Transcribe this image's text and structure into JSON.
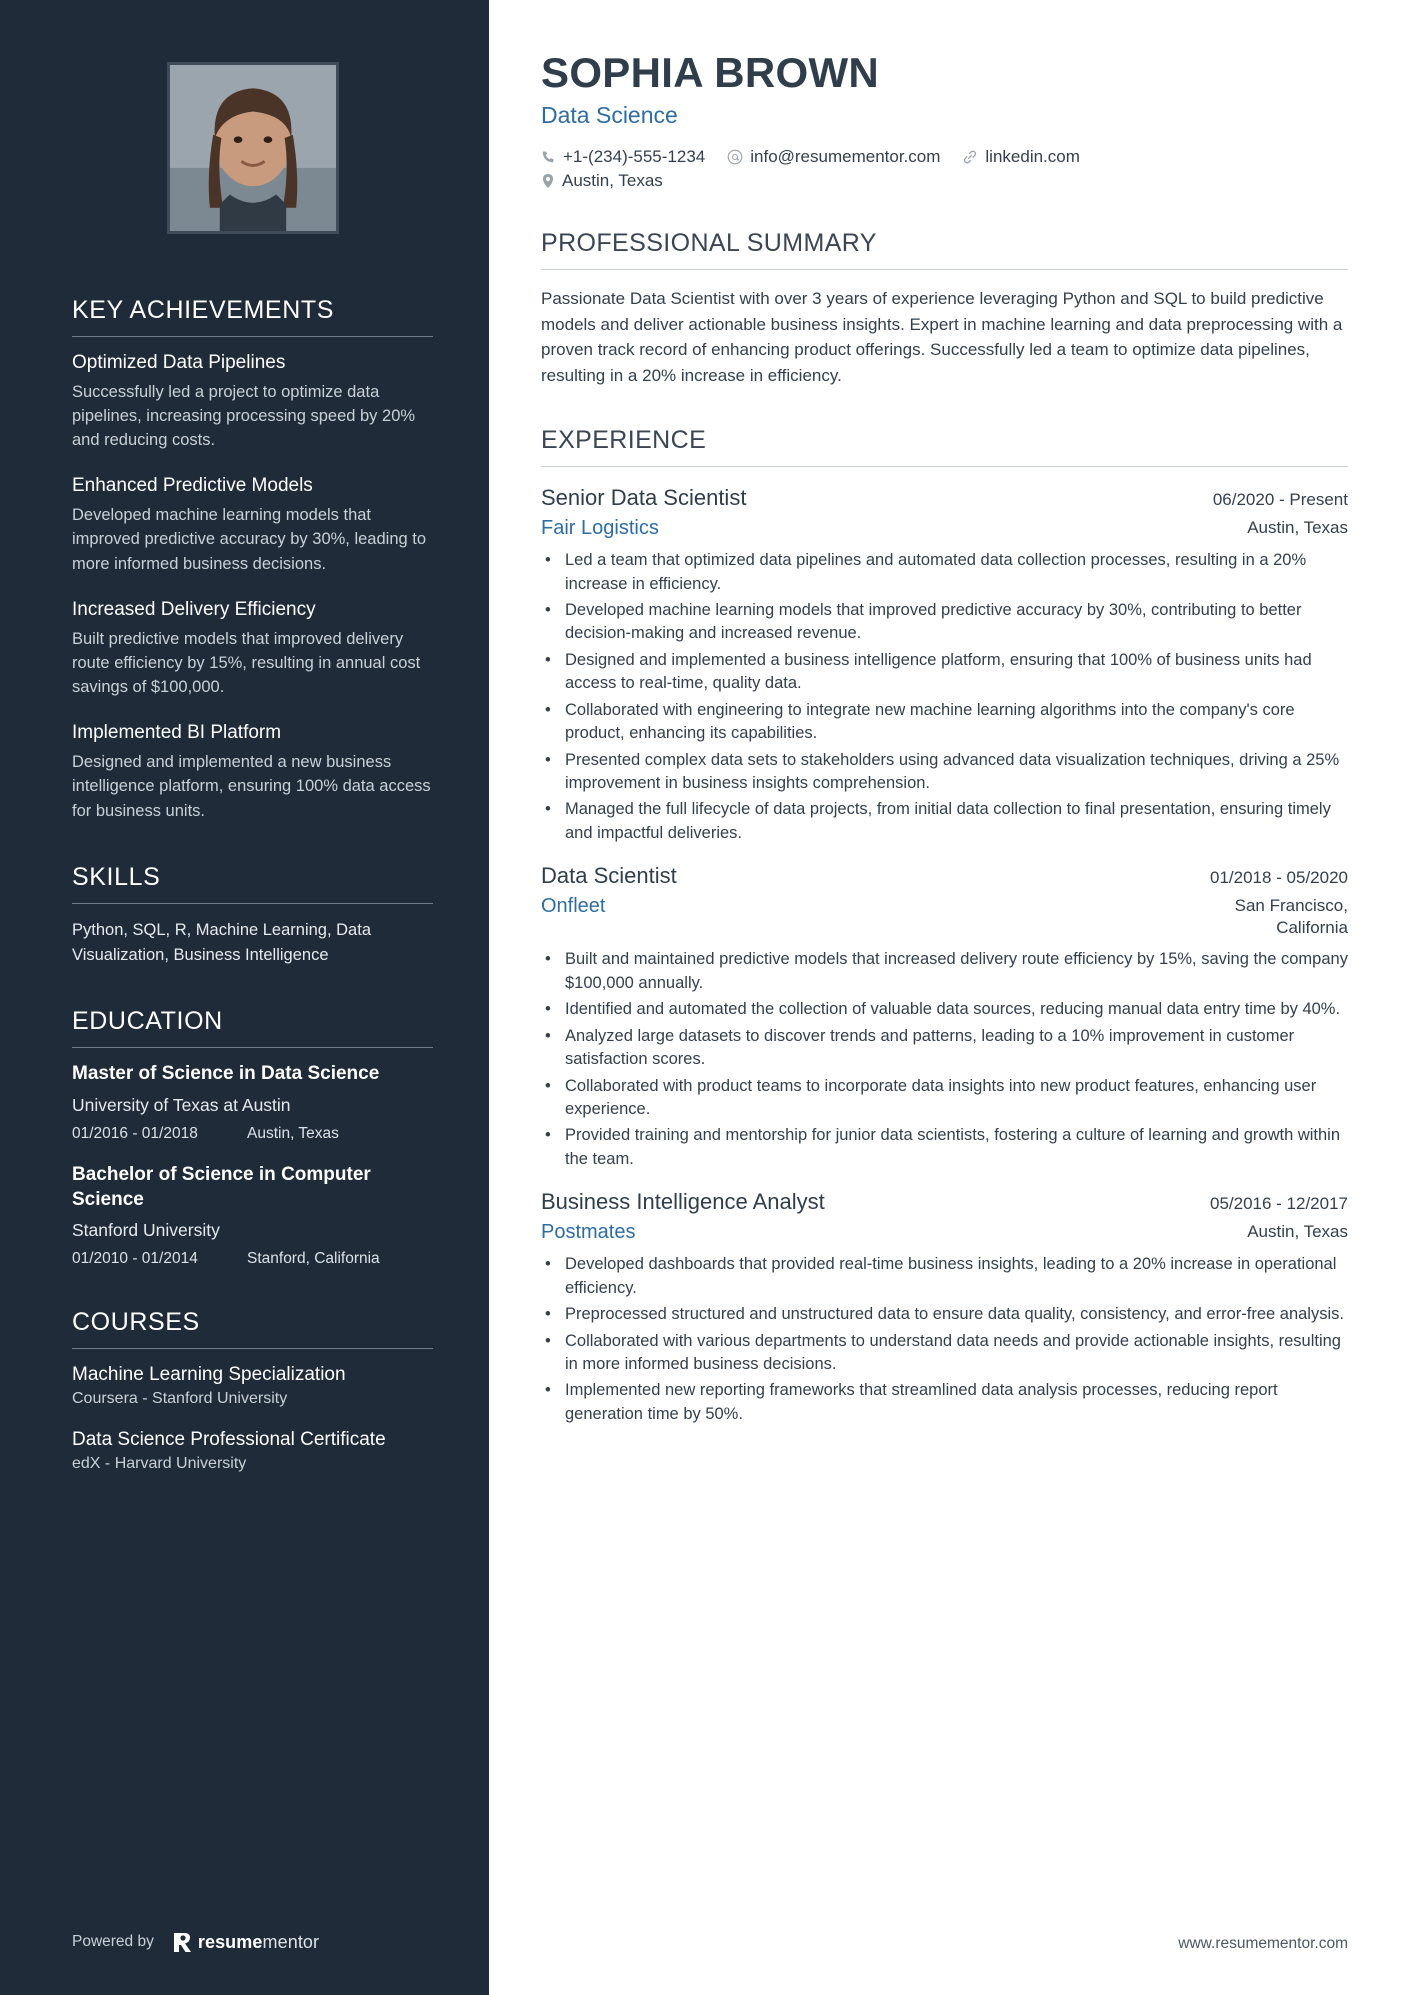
{
  "colors": {
    "sidebar_bg": "#1f2b38",
    "accent_blue": "#2e6da4",
    "heading_dark": "#303e4c",
    "body_text": "#333f4c",
    "sidebar_body": "#c9d1d7"
  },
  "header": {
    "name": "SOPHIA BROWN",
    "role": "Data Science",
    "contacts": [
      {
        "icon": "phone-icon",
        "text": "+1-(234)-555-1234"
      },
      {
        "icon": "email-icon",
        "text": "info@resumementor.com"
      },
      {
        "icon": "link-icon",
        "text": "linkedin.com"
      },
      {
        "icon": "location-icon",
        "text": "Austin, Texas"
      }
    ]
  },
  "sidebar": {
    "photo_alt": "profile-photo",
    "key_achievements": {
      "heading": "KEY ACHIEVEMENTS",
      "items": [
        {
          "title": "Optimized Data Pipelines",
          "desc": "Successfully led a project to optimize data pipelines, increasing processing speed by 20% and reducing costs."
        },
        {
          "title": "Enhanced Predictive Models",
          "desc": "Developed machine learning models that improved predictive accuracy by 30%, leading to more informed business decisions."
        },
        {
          "title": "Increased Delivery Efficiency",
          "desc": "Built predictive models that improved delivery route efficiency by 15%, resulting in annual cost savings of $100,000."
        },
        {
          "title": "Implemented BI Platform",
          "desc": "Designed and implemented a new business intelligence platform, ensuring 100% data access for business units."
        }
      ]
    },
    "skills": {
      "heading": "SKILLS",
      "text": "Python, SQL, R, Machine Learning, Data Visualization, Business Intelligence"
    },
    "education": {
      "heading": "EDUCATION",
      "items": [
        {
          "degree": "Master of Science in Data Science",
          "school": "University of Texas at Austin",
          "dates": "01/2016 - 01/2018",
          "location": "Austin, Texas"
        },
        {
          "degree": "Bachelor of Science in Computer Science",
          "school": "Stanford University",
          "dates": "01/2010 - 01/2014",
          "location": "Stanford, California"
        }
      ]
    },
    "courses": {
      "heading": "COURSES",
      "items": [
        {
          "title": "Machine Learning Specialization",
          "provider": "Coursera - Stanford University"
        },
        {
          "title": "Data Science Professional Certificate",
          "provider": "edX - Harvard University"
        }
      ]
    },
    "footer": {
      "powered_by": "Powered by",
      "logo_bold": "resume",
      "logo_light": "mentor"
    }
  },
  "main": {
    "summary": {
      "heading": "PROFESSIONAL SUMMARY",
      "text": "Passionate Data Scientist with over 3 years of experience leveraging Python and SQL to build predictive models and deliver actionable business insights. Expert in machine learning and data preprocessing with a proven track record of enhancing product offerings. Successfully led a team to optimize data pipelines, resulting in a 20% increase in efficiency."
    },
    "experience": {
      "heading": "EXPERIENCE",
      "jobs": [
        {
          "title": "Senior Data Scientist",
          "dates": "06/2020 - Present",
          "company": "Fair Logistics",
          "location": "Austin, Texas",
          "bullets": [
            "Led a team that optimized data pipelines and automated data collection processes, resulting in a 20% increase in efficiency.",
            "Developed machine learning models that improved predictive accuracy by 30%, contributing to better decision-making and increased revenue.",
            "Designed and implemented a business intelligence platform, ensuring that 100% of business units had access to real-time, quality data.",
            "Collaborated with engineering to integrate new machine learning algorithms into the company's core product, enhancing its capabilities.",
            "Presented complex data sets to stakeholders using advanced data visualization techniques, driving a 25% improvement in business insights comprehension.",
            "Managed the full lifecycle of data projects, from initial data collection to final presentation, ensuring timely and impactful deliveries."
          ]
        },
        {
          "title": "Data Scientist",
          "dates": "01/2018 - 05/2020",
          "company": "Onfleet",
          "location": "San Francisco, California",
          "bullets": [
            "Built and maintained predictive models that increased delivery route efficiency by 15%, saving the company $100,000 annually.",
            "Identified and automated the collection of valuable data sources, reducing manual data entry time by 40%.",
            "Analyzed large datasets to discover trends and patterns, leading to a 10% improvement in customer satisfaction scores.",
            "Collaborated with product teams to incorporate data insights into new product features, enhancing user experience.",
            "Provided training and mentorship for junior data scientists, fostering a culture of learning and growth within the team."
          ]
        },
        {
          "title": "Business Intelligence Analyst",
          "dates": "05/2016 - 12/2017",
          "company": "Postmates",
          "location": "Austin, Texas",
          "bullets": [
            "Developed dashboards that provided real-time business insights, leading to a 20% increase in operational efficiency.",
            "Preprocessed structured and unstructured data to ensure data quality, consistency, and error-free analysis.",
            "Collaborated with various departments to understand data needs and provide actionable insights, resulting in more informed business decisions.",
            "Implemented new reporting frameworks that streamlined data analysis processes, reducing report generation time by 50%."
          ]
        }
      ]
    },
    "footer_url": "www.resumementor.com"
  }
}
